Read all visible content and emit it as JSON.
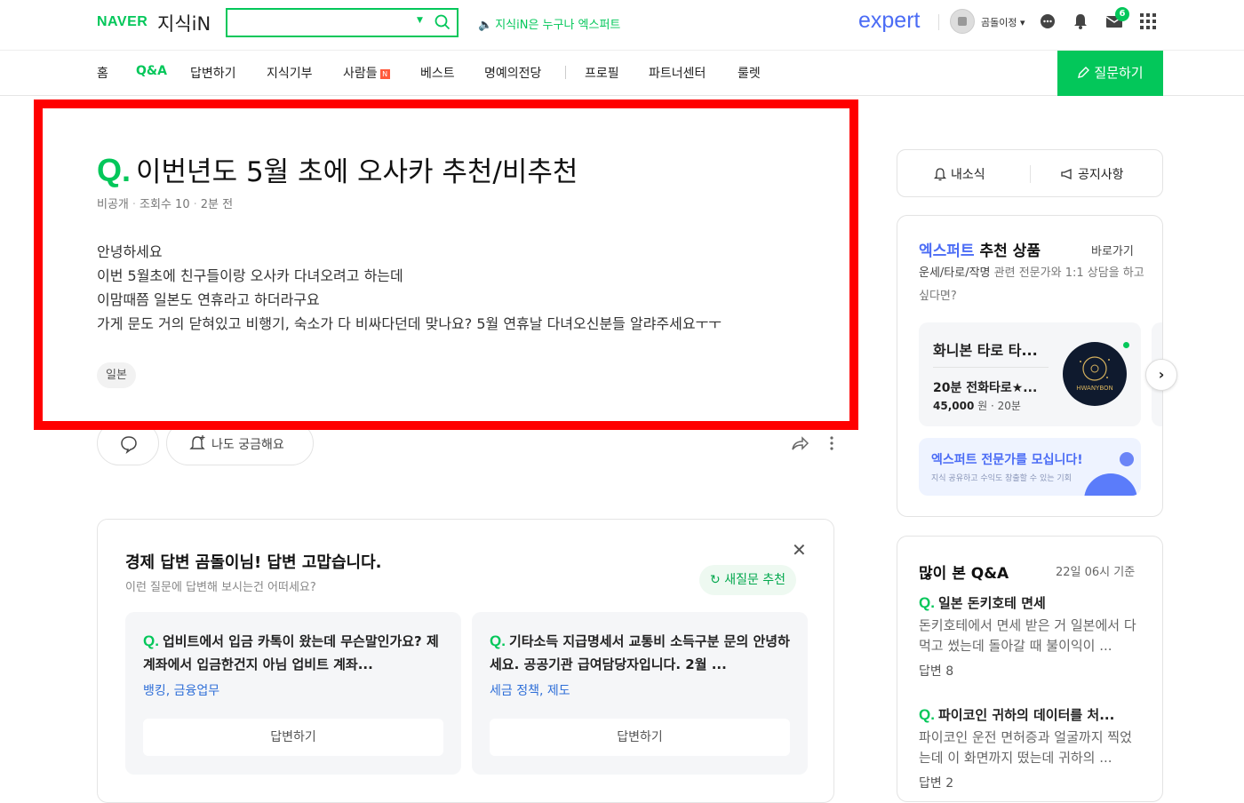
{
  "header": {
    "logo_naver": "NAVER",
    "logo_kin": "지식iN",
    "search_value": "",
    "notice": "지식iN은 누구나 엑스퍼트",
    "expert_logo": "expert",
    "username": "곰돌이정 ▾",
    "mail_badge": "6"
  },
  "nav": {
    "items": [
      "홈",
      "Q&A",
      "답변하기",
      "지식기부",
      "사람들",
      "베스트",
      "명예의전당",
      "프로필",
      "파트너센터",
      "룰렛"
    ],
    "new_badge": "N",
    "ask_button": "질문하기"
  },
  "question": {
    "q_mark": "Q.",
    "title": "이번년도 5월 초에 오사카 추천/비추천",
    "author": "비공개",
    "views": "조회수 10",
    "time": "2분 전",
    "body": [
      "안녕하세요",
      "이번 5월초에 친구들이랑 오사카 다녀오려고 하는데",
      "이맘때쯤 일본도 연휴라고 하더라구요",
      "가게 문도 거의 닫혀있고 비행기, 숙소가 다 비싸다던데 맞나요? 5월 연휴날 다녀오신분들 알랴주세요ㅜㅜ"
    ],
    "tag": "일본",
    "curious_label": "나도 궁금해요"
  },
  "recommend": {
    "title": "경제 답변 곰돌이님! 답변 고맙습니다.",
    "subtitle": "이런 질문에 답변해 보시는건 어떠세요?",
    "refresh": "새질문 추천",
    "items": [
      {
        "q": "Q.",
        "text": "업비트에서 입금 카톡이 왔는데 무슨말인가요? 제 계좌에서 입금한건지 아님 업비트 계좌...",
        "category": "뱅킹, 금융업무",
        "answer": "답변하기"
      },
      {
        "q": "Q.",
        "text": "기타소득 지급명세서 교통비 소득구분 문의 안녕하세요. 공공기관 급여담당자입니다. 2월 ...",
        "category": "세금 정책, 제도",
        "answer": "답변하기"
      }
    ]
  },
  "sidebar": {
    "tab_news": "내소식",
    "tab_notice": "공지사항",
    "expert": {
      "title_blue": "엑스퍼트",
      "title_rest": " 추천 상품",
      "goto": "바로가기",
      "desc_bold": "운세/타로/작명",
      "desc_rest": " 관련 전문가와 1:1 상담을 하고 싶다면?",
      "product_name": "화니본 타로 타...",
      "product_title": "20분 전화타로★...",
      "price": "45,000",
      "price_unit": "원 · 20분",
      "image_text": "HWANYBON",
      "banner_title": "엑스퍼트 전문가를 모십니다!",
      "banner_sub": "지식 공유하고 수익도 창출할 수 있는 기회"
    },
    "popular": {
      "title": "많이 본 Q&A",
      "time": "22일 06시 기준",
      "items": [
        {
          "q": "Q.",
          "title": "일본 돈키호테 면세",
          "answer": "돈키호테에서 면세 받은 거 일본에서 다 먹고 썼는데 돌아갈 때 불이익이 ...",
          "count": "답변 8"
        },
        {
          "q": "Q.",
          "title": "파이코인 귀하의 데이터를 처...",
          "answer": "파이코인 운전 면허증과 얼굴까지 찍었는데 이 화면까지 떴는데 귀하의 ...",
          "count": "답변 2"
        }
      ]
    }
  },
  "colors": {
    "brand_green": "#03c75a",
    "expert_blue": "#4b6cf5",
    "highlight_red": "#ff0000"
  }
}
